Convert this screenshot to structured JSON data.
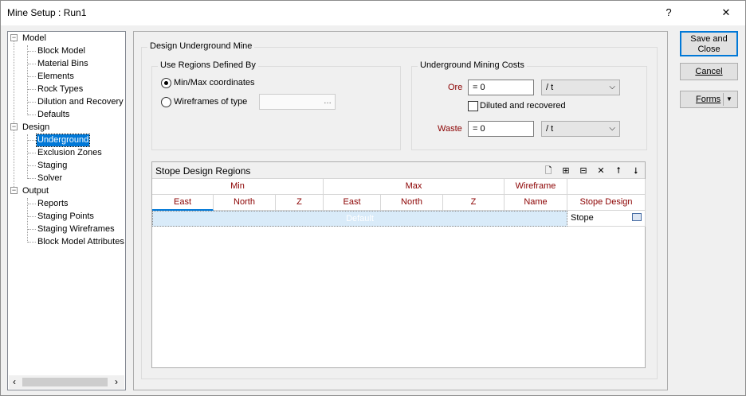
{
  "window": {
    "title": "Mine Setup : Run1",
    "help": "?",
    "close": "✕"
  },
  "tree": {
    "model": "Model",
    "model_items": [
      "Block Model",
      "Material Bins",
      "Elements",
      "Rock Types",
      "Dilution and Recovery",
      "Defaults"
    ],
    "design": "Design",
    "design_items": [
      "Underground",
      "Exclusion Zones",
      "Staging",
      "Solver"
    ],
    "output": "Output",
    "output_items": [
      "Reports",
      "Staging Points",
      "Staging Wireframes",
      "Block Model Attributes"
    ],
    "expander": "−",
    "scroll_left": "‹",
    "scroll_right": "›"
  },
  "design_group": "Design Underground Mine",
  "regions": {
    "legend": "Use Regions Defined By",
    "opt_minmax": "Min/Max coordinates",
    "opt_wireframes": "Wireframes of type",
    "browse": "…"
  },
  "costs": {
    "legend": "Underground Mining Costs",
    "ore_label": "Ore",
    "ore_value": "= 0",
    "ore_unit": "/ t",
    "diluted_label": "Diluted and recovered",
    "waste_label": "Waste",
    "waste_value": "= 0",
    "waste_unit": "/ t",
    "dropdown_arrow": "⌵"
  },
  "stope_grid": {
    "title": "Stope Design Regions",
    "icons": [
      "🗋",
      "⊞",
      "⊟",
      "✕",
      "⭡",
      "⭣"
    ],
    "groups": [
      "Min",
      "Max",
      "Wireframe",
      ""
    ],
    "columns": [
      "East",
      "North",
      "Z",
      "East",
      "North",
      "Z",
      "Name",
      "Stope Design"
    ],
    "rows": [
      {
        "name": "Default",
        "stope": "Stope"
      }
    ]
  },
  "buttons": {
    "save": "Save and Close",
    "cancel": "Cancel",
    "forms": "Forms",
    "forms_arrow": "▼"
  }
}
